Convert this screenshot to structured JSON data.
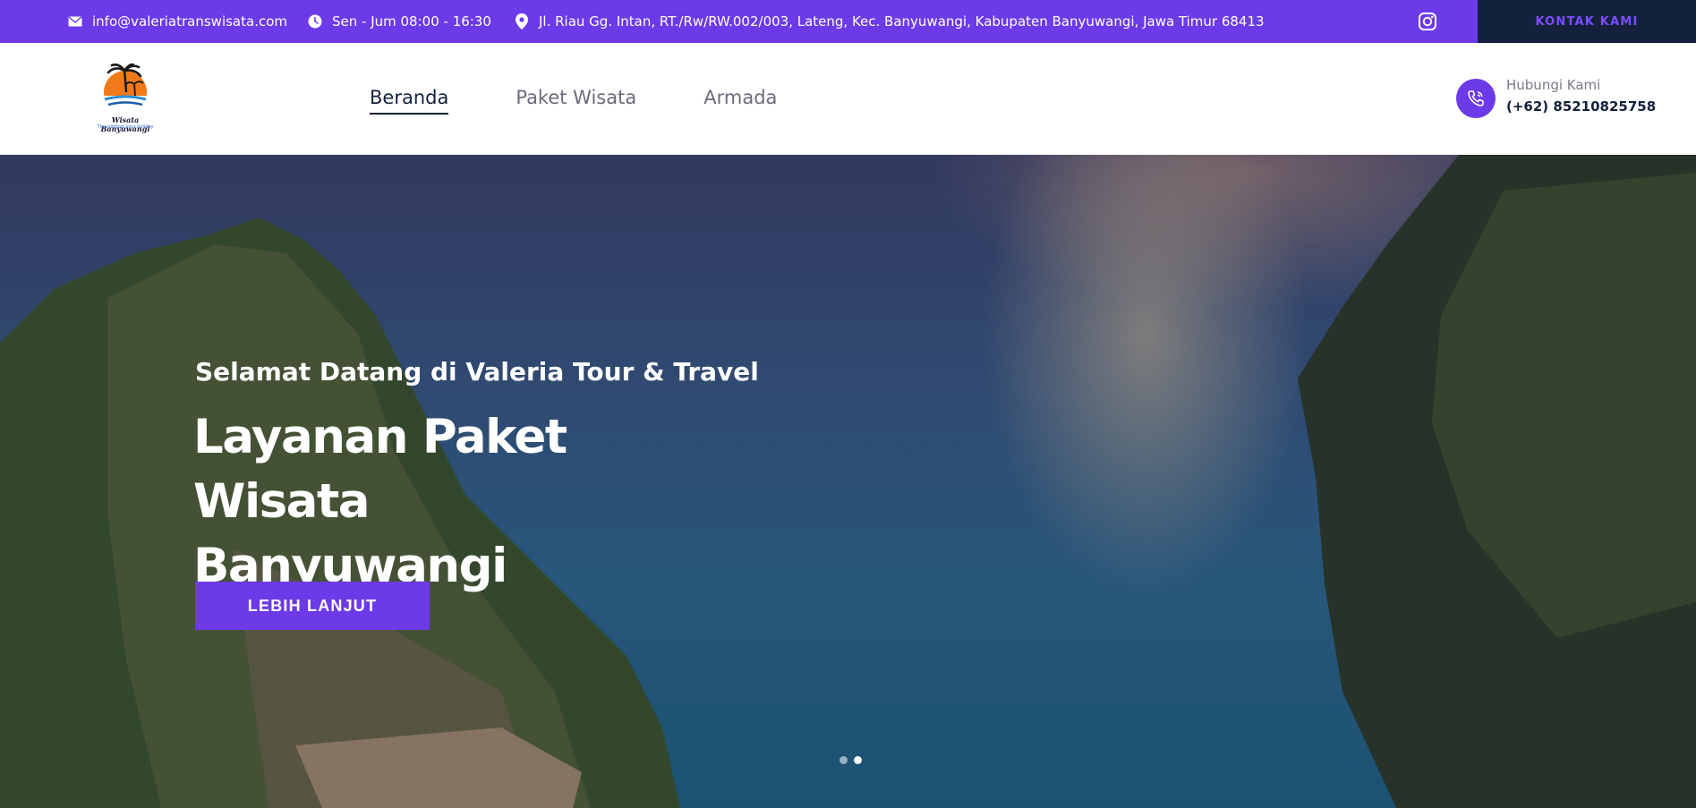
{
  "topbar": {
    "email": "info@valeriatranswisata.com",
    "hours": "Sen - Jum 08:00 - 16:30",
    "address": "Jl. Riau Gg. Intan, RT./Rw/RW.002/003, Lateng, Kec. Banyuwangi, Kabupaten Banyuwangi, Jawa Timur 68413",
    "contact_button": "KONTAK KAMI",
    "icons": {
      "email": "mail-icon",
      "hours": "clock-icon",
      "address": "location-pin-icon",
      "social": "instagram-icon"
    }
  },
  "header": {
    "logo": {
      "name": "Wisata Banyuwangi",
      "tagline": "The comfort your holiday"
    },
    "nav": [
      {
        "label": "Beranda",
        "active": true
      },
      {
        "label": "Paket Wisata",
        "active": false
      },
      {
        "label": "Armada",
        "active": false
      }
    ],
    "call": {
      "label": "Hubungi Kami",
      "number": "(+62) 85210825758",
      "icon": "phone-icon"
    }
  },
  "hero": {
    "subtitle": "Selamat Datang di Valeria Tour & Travel",
    "title": "Layanan Paket Wisata Banyuwangi",
    "cta": "LEBIH LANJUT",
    "slides": {
      "count": 2,
      "active": 2
    }
  },
  "colors": {
    "accent": "#6c3ae7",
    "dark": "#14213d",
    "contact_text": "#7c4dff"
  }
}
